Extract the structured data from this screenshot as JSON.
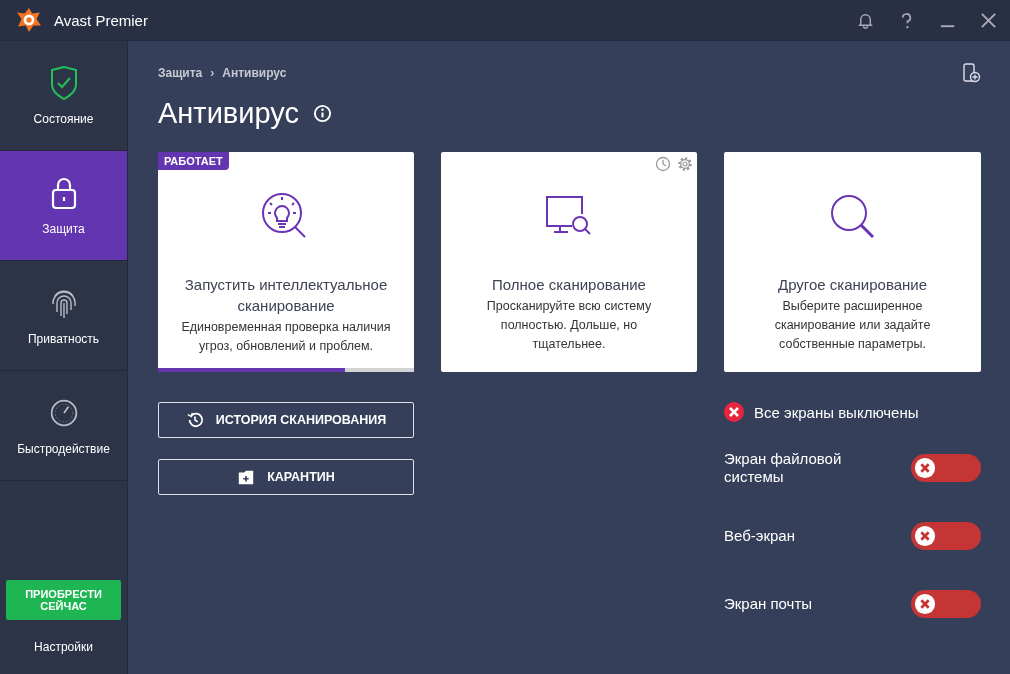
{
  "window": {
    "title": "Avast Premier"
  },
  "sidebar": {
    "items": [
      {
        "label": "Состояние",
        "kind": "shield",
        "selected": false
      },
      {
        "label": "Защита",
        "kind": "lock",
        "selected": true
      },
      {
        "label": "Приватность",
        "kind": "fingerprint",
        "selected": false
      },
      {
        "label": "Быстродействие",
        "kind": "gauge",
        "selected": false
      }
    ],
    "buy_button": "ПРИОБРЕСТИ СЕЙЧАС",
    "settings": "Настройки"
  },
  "breadcrumb": [
    "Защита",
    "Антивирус"
  ],
  "breadcrumb_separator": "›",
  "page_title": "Антивирус",
  "scan_cards": [
    {
      "kind": "bulb",
      "badge": "РАБОТАЕТ",
      "title": "Запустить интеллектуальное сканирование",
      "description": "Единовременная проверка наличия угроз, обновлений и проблем.",
      "level": 0.73,
      "tools": false
    },
    {
      "kind": "monitor",
      "title": "Полное сканирование",
      "description": "Просканируйте всю систему полностью. Дольше, но тщательнее.",
      "tools": true
    },
    {
      "kind": "magnifier",
      "title": "Другое сканирование",
      "description": "Выберите расширенное сканирование или задайте собственные параметры.",
      "tools": false
    }
  ],
  "actions": [
    {
      "kind": "history",
      "label": "ИСТОРИЯ СКАНИРОВАНИЯ"
    },
    {
      "kind": "quarantine",
      "label": "КАРАНТИН"
    }
  ],
  "shields_status": "Все экраны выключены",
  "shields": [
    {
      "label": "Экран файловой системы",
      "on": false
    },
    {
      "label": "Веб-экран",
      "on": false
    },
    {
      "label": "Экран почты",
      "on": false
    }
  ]
}
